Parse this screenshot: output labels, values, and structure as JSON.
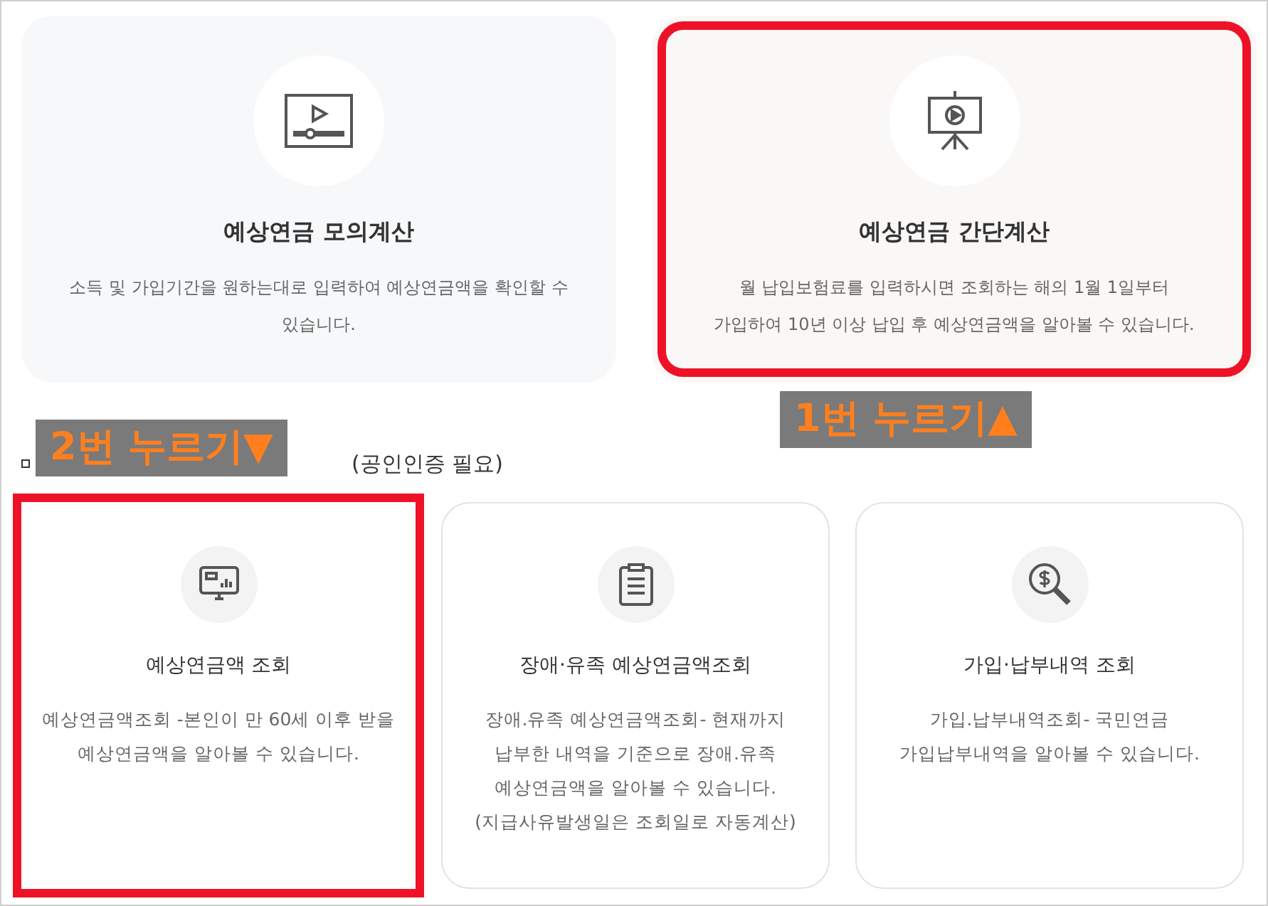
{
  "top_cards": [
    {
      "kind": "video",
      "title": "예상연금 모의계산",
      "description": "소득 및 가입기간을 원하는대로 입력하여 예상연금액을 확인할 수 있습니다.",
      "highlighted": false
    },
    {
      "kind": "presentation",
      "title": "예상연금 간단계산",
      "description": "월 납입보험료를 입력하시면 조회하는 해의 1월 1일부터\n가입하여 10년 이상 납입 후 예상연금액을 알아볼 수 있습니다.",
      "highlighted": true
    }
  ],
  "annotations": [
    {
      "text": "2번 누르기▼"
    },
    {
      "text": "1번 누르기▲"
    }
  ],
  "section_heading": "(공인인증 필요)",
  "bottom_cards": [
    {
      "kind": "monitor",
      "title": "예상연금액 조회",
      "description": "예상연금액조회 -본인이 만 60세 이후 받을\n예상연금액을 알아볼 수 있습니다.",
      "highlighted": true
    },
    {
      "kind": "clipboard",
      "title": "장애·유족 예상연금액조회",
      "description": "장애.유족 예상연금액조회- 현재까지\n납부한 내역을 기준으로 장애.유족\n예상연금액을 알아볼 수 있습니다.\n(지급사유발생일은 조회일로 자동계산)",
      "highlighted": false
    },
    {
      "kind": "search-dollar",
      "title": "가입·납부내역 조회",
      "description": "가입.납부내역조회- 국민연금\n가입납부내역을 알아볼 수 있습니다.",
      "highlighted": false
    }
  ]
}
